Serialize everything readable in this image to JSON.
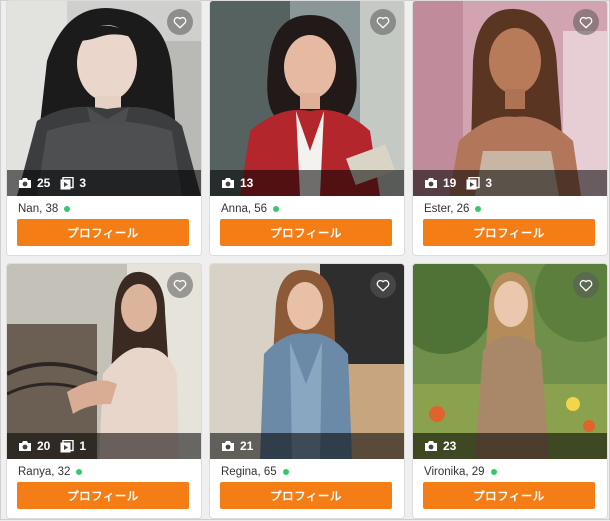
{
  "colors": {
    "accent": "#f47d15",
    "online": "#35c76c",
    "overlay": "rgba(0,0,0,0.55)"
  },
  "icons": {
    "favorite": "heart-outline-icon",
    "photos": "camera-icon",
    "videos": "video-play-icon"
  },
  "profiles": [
    {
      "name": "Nan",
      "age": "38",
      "name_age": "Nan, 38",
      "photos": "25",
      "videos": "3",
      "online": true,
      "button_label": "プロフィール"
    },
    {
      "name": "Anna",
      "age": "56",
      "name_age": "Anna, 56",
      "photos": "13",
      "videos": "",
      "online": true,
      "button_label": "プロフィール"
    },
    {
      "name": "Ester",
      "age": "26",
      "name_age": "Ester, 26",
      "photos": "19",
      "videos": "3",
      "online": true,
      "button_label": "プロフィール"
    },
    {
      "name": "Ranya",
      "age": "32",
      "name_age": "Ranya, 32",
      "photos": "20",
      "videos": "1",
      "online": true,
      "button_label": "プロフィール"
    },
    {
      "name": "Regina",
      "age": "65",
      "name_age": "Regina, 65",
      "photos": "21",
      "videos": "",
      "online": true,
      "button_label": "プロフィール"
    },
    {
      "name": "Vironika",
      "age": "29",
      "name_age": "Vironika, 29",
      "photos": "23",
      "videos": "",
      "online": true,
      "button_label": "プロフィール"
    }
  ]
}
